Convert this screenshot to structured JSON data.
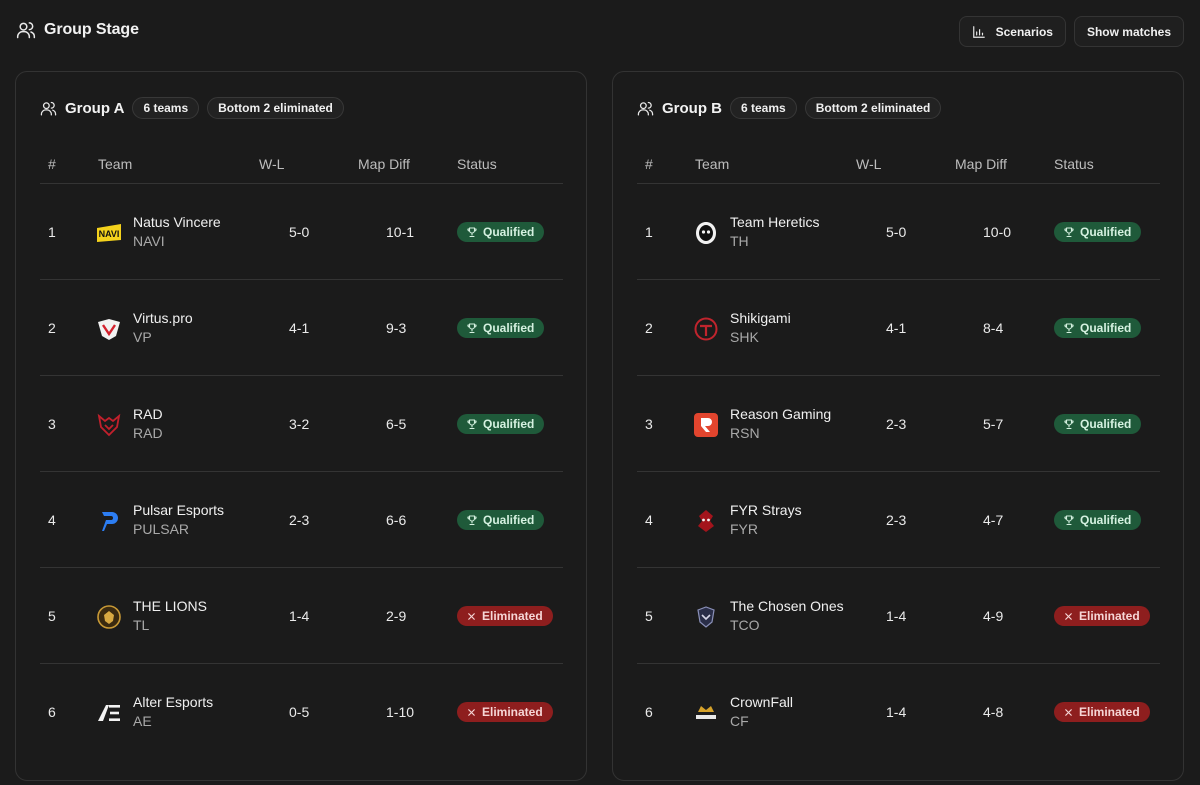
{
  "header": {
    "title": "Group Stage",
    "scenarios_label": "Scenarios",
    "show_matches_label": "Show matches"
  },
  "columns": {
    "rank": "#",
    "team": "Team",
    "wl": "W-L",
    "map_diff": "Map Diff",
    "status": "Status"
  },
  "status_labels": {
    "qualified": "Qualified",
    "eliminated": "Eliminated"
  },
  "colors": {
    "qualified_bg": "#1f5a3a",
    "eliminated_bg": "#8e1e1e",
    "background": "#1b1b1b"
  },
  "groups": [
    {
      "title": "Group A",
      "teams_badge": "6 teams",
      "elim_badge": "Bottom 2 eliminated",
      "rows": [
        {
          "rank": "1",
          "name": "Natus Vincere",
          "tag": "NAVI",
          "wl": "5-0",
          "map_diff": "10-1",
          "status": "Qualified",
          "logo": "navi-logo"
        },
        {
          "rank": "2",
          "name": "Virtus.pro",
          "tag": "VP",
          "wl": "4-1",
          "map_diff": "9-3",
          "status": "Qualified",
          "logo": "virtuspro-logo"
        },
        {
          "rank": "3",
          "name": "RAD",
          "tag": "RAD",
          "wl": "3-2",
          "map_diff": "6-5",
          "status": "Qualified",
          "logo": "rad-logo"
        },
        {
          "rank": "4",
          "name": "Pulsar Esports",
          "tag": "PULSAR",
          "wl": "2-3",
          "map_diff": "6-6",
          "status": "Qualified",
          "logo": "pulsar-logo"
        },
        {
          "rank": "5",
          "name": "THE LIONS",
          "tag": "TL",
          "wl": "1-4",
          "map_diff": "2-9",
          "status": "Eliminated",
          "logo": "lions-logo"
        },
        {
          "rank": "6",
          "name": "Alter Esports",
          "tag": "AE",
          "wl": "0-5",
          "map_diff": "1-10",
          "status": "Eliminated",
          "logo": "alter-logo"
        }
      ]
    },
    {
      "title": "Group B",
      "teams_badge": "6 teams",
      "elim_badge": "Bottom 2 eliminated",
      "rows": [
        {
          "rank": "1",
          "name": "Team Heretics",
          "tag": "TH",
          "wl": "5-0",
          "map_diff": "10-0",
          "status": "Qualified",
          "logo": "heretics-logo"
        },
        {
          "rank": "2",
          "name": "Shikigami",
          "tag": "SHK",
          "wl": "4-1",
          "map_diff": "8-4",
          "status": "Qualified",
          "logo": "shikigami-logo"
        },
        {
          "rank": "3",
          "name": "Reason Gaming",
          "tag": "RSN",
          "wl": "2-3",
          "map_diff": "5-7",
          "status": "Qualified",
          "logo": "reason-logo"
        },
        {
          "rank": "4",
          "name": "FYR Strays",
          "tag": "FYR",
          "wl": "2-3",
          "map_diff": "4-7",
          "status": "Qualified",
          "logo": "fyr-logo"
        },
        {
          "rank": "5",
          "name": "The Chosen Ones",
          "tag": "TCO",
          "wl": "1-4",
          "map_diff": "4-9",
          "status": "Eliminated",
          "logo": "chosen-logo"
        },
        {
          "rank": "6",
          "name": "CrownFall",
          "tag": "CF",
          "wl": "1-4",
          "map_diff": "4-8",
          "status": "Eliminated",
          "logo": "crownfall-logo"
        }
      ]
    }
  ]
}
